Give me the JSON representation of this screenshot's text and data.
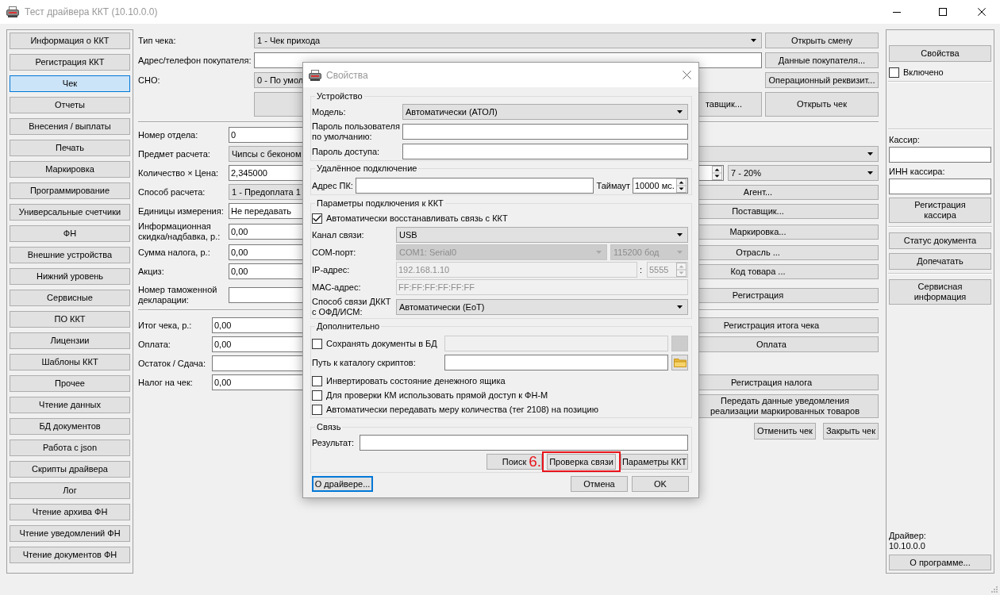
{
  "window": {
    "title": "Тест драйвера ККТ (10.10.0.0)"
  },
  "sidebar": {
    "items": [
      {
        "label": "Информация о ККТ",
        "selected": false
      },
      {
        "label": "Регистрация ККТ",
        "selected": false
      },
      {
        "label": "Чек",
        "selected": true
      },
      {
        "label": "Отчеты",
        "selected": false
      },
      {
        "label": "Внесения / выплаты",
        "selected": false
      },
      {
        "label": "Печать",
        "selected": false
      },
      {
        "label": "Маркировка",
        "selected": false
      },
      {
        "label": "Программирование",
        "selected": false
      },
      {
        "label": "Универсальные счетчики",
        "selected": false
      },
      {
        "label": "ФН",
        "selected": false
      },
      {
        "label": "Внешние устройства",
        "selected": false
      },
      {
        "label": "Нижний уровень",
        "selected": false
      },
      {
        "label": "Сервисные",
        "selected": false
      },
      {
        "label": "ПО ККТ",
        "selected": false
      },
      {
        "label": "Лицензии",
        "selected": false
      },
      {
        "label": "Шаблоны ККТ",
        "selected": false
      },
      {
        "label": "Прочее",
        "selected": false
      },
      {
        "label": "Чтение данных",
        "selected": false
      },
      {
        "label": "БД документов",
        "selected": false
      },
      {
        "label": "Работа с json",
        "selected": false
      },
      {
        "label": "Скрипты драйвера",
        "selected": false
      },
      {
        "label": "Лог",
        "selected": false
      },
      {
        "label": "Чтение архива ФН",
        "selected": false
      },
      {
        "label": "Чтение уведомлений ФН",
        "selected": false
      },
      {
        "label": "Чтение документов ФН",
        "selected": false
      }
    ]
  },
  "receipt_form": {
    "header_rows": [
      {
        "kind": "combo",
        "label": "Тип чека:",
        "value": "1 - Чек прихода",
        "button": "Открыть смену"
      },
      {
        "kind": "input",
        "label": "Адрес/телефон покупателя:",
        "button": "Данные покупателя..."
      },
      {
        "kind": "combo",
        "label": "СНО:",
        "value": "0 - По умол",
        "button": "Операционный реквизит..."
      }
    ],
    "action_buttons": [
      "тавщик...",
      "Открыть чек"
    ],
    "item_rows": [
      {
        "kind": "input",
        "label": "Номер отдела:",
        "value": "0"
      },
      {
        "kind": "combo_wide",
        "label": "Предмет расчета:",
        "value": "Чипсы с беконом"
      },
      {
        "kind": "qty_price",
        "label": "Количество × Цена:",
        "value": "2,345000",
        "tax": "7 - 20%"
      },
      {
        "kind": "combo",
        "label": "Способ расчета:",
        "value": "1 - Предоплата 1",
        "button": "Агент..."
      },
      {
        "kind": "input",
        "label": "Единицы измерения:",
        "value": "Не передавать",
        "button": "Поставщик..."
      },
      {
        "kind": "input",
        "label": "Информационная скидка/надбавка, р.:",
        "value": "0,00",
        "button": "Маркировка..."
      },
      {
        "kind": "input",
        "label": "Сумма налога, р.:",
        "value": "0,00",
        "button": "Отрасль ..."
      },
      {
        "kind": "input",
        "label": "Акциз:",
        "value": "0,00",
        "button": "Код товара ..."
      },
      {
        "kind": "input",
        "label": "Номер таможенной декларации:",
        "button": "Регистрация"
      }
    ],
    "total_rows": [
      {
        "label": "Итог чека, р.:",
        "value": "0,00",
        "button": "Регистрация итога чека"
      },
      {
        "label": "Оплата:",
        "value": "0,00",
        "button": "Оплата"
      },
      {
        "label": "Остаток / Сдача:"
      },
      {
        "label": "Налог на чек:",
        "value": "0,00",
        "button": "Регистрация налога"
      }
    ],
    "notification_button": "Передать данные уведомления реализации маркированных товаров",
    "footer_buttons": [
      "Отменить чек",
      "Закрыть чек"
    ]
  },
  "right_panel": {
    "properties_button": "Свойства",
    "enabled": {
      "label": "Включено",
      "checked": false
    },
    "cashier_label": "Кассир:",
    "cashier_inn_label": "ИНН кассира:",
    "register_cashier_button": "Регистрация кассира",
    "document_buttons": [
      "Статус документа",
      "Допечатать"
    ],
    "service_info_button": "Сервисная информация",
    "driver_label": "Драйвер:",
    "driver_version": "10.10.0.0",
    "about_button": "О программе..."
  },
  "dialog": {
    "title": "Свойства",
    "device": {
      "title": "Устройство",
      "model_label": "Модель:",
      "model": "Автоматически (АТОЛ)",
      "user_password_label": "Пароль пользователя по умолчанию:",
      "access_password_label": "Пароль доступа:"
    },
    "remote": {
      "title": "Удалённое подключение",
      "address_label": "Адрес ПК:",
      "timeout_label": "Таймаут",
      "timeout": "10000 мс."
    },
    "connection": {
      "title": "Параметры подключения к ККТ",
      "auto_reconnect": {
        "label": "Автоматически восстанавливать связь с ККТ",
        "checked": true
      },
      "channel_label": "Канал связи:",
      "channel": "USB",
      "com_port": {
        "label": "COM-порт:",
        "port": "COM1: Serial0",
        "baud": "115200 бод",
        "disabled": true
      },
      "ip": {
        "label": "IP-адрес:",
        "address": "192.168.1.10",
        "separator": ":",
        "port": "5555",
        "disabled": true
      },
      "mac": {
        "label": "MAC-адрес:",
        "address": "FF:FF:FF:FF:FF:FF",
        "disabled": true
      },
      "ofd_label": "Способ связи ДККТ с ОФД/ИСМ:",
      "ofd": "Автоматически (EoT)"
    },
    "extra": {
      "title": "Дополнительно",
      "options": [
        {
          "kind": "checkbox_path",
          "label": "Сохранять документы в БД",
          "checked": false,
          "disabled": true
        },
        {
          "kind": "path",
          "label": "Путь к каталогу скриптов:",
          "disabled": false
        },
        {
          "kind": "checkbox",
          "label": "Инвертировать состояние денежного ящика",
          "checked": false
        },
        {
          "kind": "checkbox",
          "label": "Для проверки КМ использовать прямой доступ к ФН-М",
          "checked": false
        },
        {
          "kind": "checkbox",
          "label": "Автоматически передавать меру количества (тег 2108) на позицию",
          "checked": false
        }
      ]
    },
    "link": {
      "title": "Связь",
      "result_label": "Результат:",
      "step_marker": "6.",
      "buttons": [
        {
          "label": "Поиск",
          "highlighted": false
        },
        {
          "label": "Проверка связи",
          "highlighted": true
        },
        {
          "label": "Параметры ККТ",
          "highlighted": false
        }
      ]
    },
    "footer_buttons": [
      {
        "label": "О драйвере...",
        "focused": true
      },
      {
        "label": "Отмена",
        "focused": false
      },
      {
        "label": "OK",
        "focused": false
      }
    ]
  }
}
